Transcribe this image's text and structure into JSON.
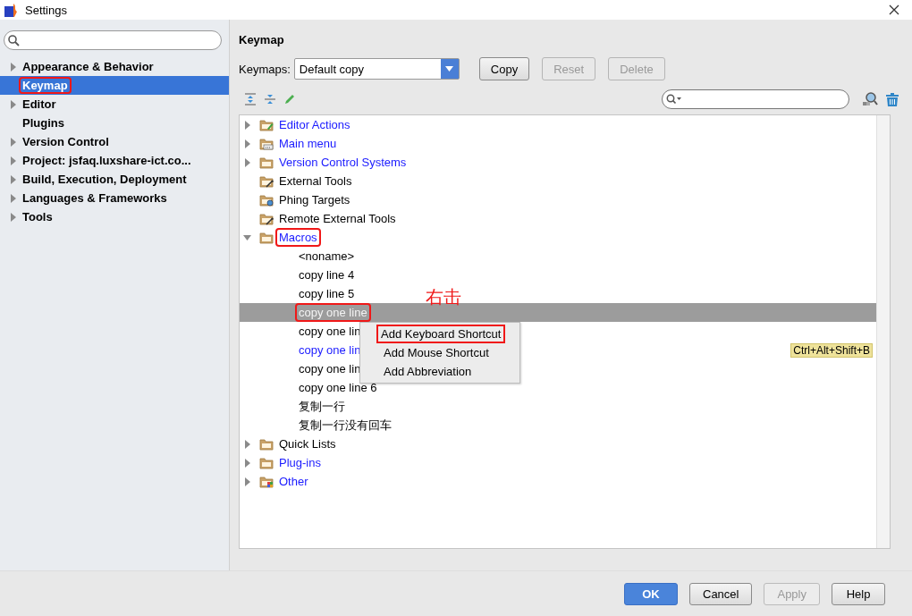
{
  "window": {
    "title": "Settings"
  },
  "sidebar": {
    "items": [
      {
        "label": "Appearance & Behavior",
        "expanded": false,
        "selected": false,
        "annotated": false
      },
      {
        "label": "Keymap",
        "selected": true,
        "annotated": true
      },
      {
        "label": "Editor",
        "expanded": false,
        "selected": false,
        "annotated": false
      },
      {
        "label": "Plugins",
        "selected": false,
        "annotated": false
      },
      {
        "label": "Version Control",
        "expanded": false,
        "selected": false,
        "annotated": false
      },
      {
        "label": "Project: jsfaq.luxshare-ict.co...",
        "expanded": false,
        "selected": false,
        "annotated": false
      },
      {
        "label": "Build, Execution, Deployment",
        "expanded": false,
        "selected": false,
        "annotated": false
      },
      {
        "label": "Languages & Frameworks",
        "expanded": false,
        "selected": false,
        "annotated": false
      },
      {
        "label": "Tools",
        "expanded": false,
        "selected": false,
        "annotated": false
      }
    ]
  },
  "page": {
    "title": "Keymap",
    "keymaps_label": "Keymaps:",
    "keymap_value": "Default copy",
    "buttons": [
      {
        "label": "Copy",
        "disabled": false
      },
      {
        "label": "Reset",
        "disabled": true
      },
      {
        "label": "Delete",
        "disabled": true
      }
    ]
  },
  "tree": {
    "items": [
      {
        "label": "Editor Actions",
        "kind": "editor",
        "expanded": false,
        "modified": true,
        "annotated": false
      },
      {
        "label": "Main menu",
        "kind": "menu",
        "expanded": false,
        "modified": true,
        "annotated": false
      },
      {
        "label": "Version Control Systems",
        "kind": "folder",
        "expanded": false,
        "modified": true,
        "annotated": false
      },
      {
        "label": "External Tools",
        "kind": "tools",
        "modified": false,
        "annotated": false
      },
      {
        "label": "Phing Targets",
        "kind": "gear",
        "modified": false,
        "annotated": false
      },
      {
        "label": "Remote External Tools",
        "kind": "tools",
        "modified": false,
        "annotated": false
      },
      {
        "label": "Macros",
        "kind": "folder",
        "expanded": true,
        "modified": true,
        "annotated": true,
        "children": [
          {
            "label": "<noname>",
            "modified": false,
            "selected": false,
            "annotated": false
          },
          {
            "label": "copy line 4",
            "modified": false,
            "selected": false,
            "annotated": false
          },
          {
            "label": "copy line 5",
            "modified": false,
            "selected": false,
            "annotated": false
          },
          {
            "label": "copy one line",
            "modified": false,
            "selected": true,
            "annotated": true
          },
          {
            "label": "copy one lin",
            "modified": false,
            "selected": false,
            "annotated": false
          },
          {
            "label": "copy one lin",
            "modified": true,
            "selected": false,
            "annotated": false,
            "shortcut": "Ctrl+Alt+Shift+B"
          },
          {
            "label": "copy one lin",
            "modified": false,
            "selected": false,
            "annotated": false
          },
          {
            "label": "copy one line 6",
            "modified": false,
            "selected": false,
            "annotated": false
          },
          {
            "label": "复制一行",
            "modified": false,
            "selected": false,
            "annotated": false
          },
          {
            "label": "复制一行没有回车",
            "modified": false,
            "selected": false,
            "annotated": false
          }
        ]
      },
      {
        "label": "Quick Lists",
        "kind": "folder",
        "expanded": false,
        "modified": false,
        "annotated": false
      },
      {
        "label": "Plug-ins",
        "kind": "folder",
        "expanded": false,
        "modified": true,
        "annotated": false
      },
      {
        "label": "Other",
        "kind": "other",
        "expanded": false,
        "modified": true,
        "annotated": false
      }
    ]
  },
  "context_menu": {
    "items": [
      {
        "label": "Add Keyboard Shortcut",
        "annotated": true
      },
      {
        "label": "Add Mouse Shortcut",
        "annotated": false
      },
      {
        "label": "Add Abbreviation",
        "annotated": false
      }
    ]
  },
  "annotation": {
    "text": "右击"
  },
  "footer": {
    "buttons": [
      {
        "label": "OK",
        "kind": "primary",
        "disabled": false
      },
      {
        "label": "Cancel",
        "kind": "normal",
        "disabled": false
      },
      {
        "label": "Apply",
        "kind": "normal",
        "disabled": true
      },
      {
        "label": "Help",
        "kind": "normal",
        "disabled": false
      }
    ]
  }
}
